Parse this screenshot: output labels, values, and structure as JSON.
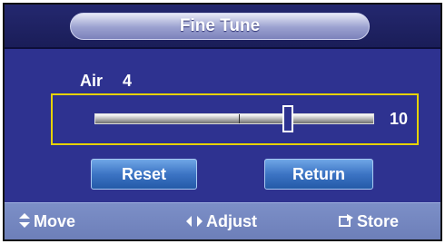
{
  "window": {
    "title": "Fine Tune"
  },
  "setting": {
    "label": "Air",
    "value": "4"
  },
  "slider": {
    "display_value": "10",
    "level_fraction": 0.69
  },
  "buttons": {
    "reset_label": "Reset",
    "return_label": "Return"
  },
  "footer": {
    "move_label": "Move",
    "move_icon": "up-down-arrows-icon",
    "adjust_label": "Adjust",
    "adjust_icon": "left-right-arrows-icon",
    "store_label": "Store",
    "store_icon": "store-icon"
  },
  "colors": {
    "panel_bg": "#2e3290",
    "highlight_border": "#e6d200",
    "button_bg": "#3c74c4",
    "footer_bg": "#7c8fc7"
  }
}
